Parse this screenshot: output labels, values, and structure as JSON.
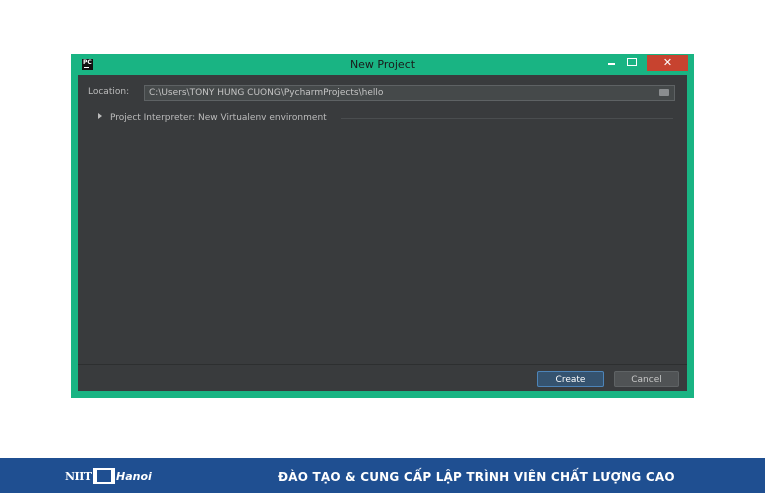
{
  "window": {
    "title": "New Project",
    "app_icon_text": "PC",
    "close_glyph": "✕",
    "icons": {
      "app": "pycharm-icon",
      "minimize": "minimize-icon",
      "maximize": "maximize-icon",
      "close": "close-icon"
    },
    "colors": {
      "frame": "#19b483",
      "client_bg": "#393b3d",
      "close_button": "#c7432f",
      "primary_button": "#35536f"
    }
  },
  "form": {
    "location_label": "Location:",
    "location_value": "C:\\Users\\TONY HUNG CUONG\\PycharmProjects\\hello",
    "folder_icon": "folder-icon",
    "interpreter_label": "Project Interpreter: New Virtualenv environment"
  },
  "buttons": {
    "create": "Create",
    "cancel": "Cancel"
  },
  "banner": {
    "logo_left": "NIIT",
    "logo_right": "Hanoi",
    "slogan": "ĐÀO TẠO & CUNG CẤP LẬP TRÌNH VIÊN CHẤT LƯỢNG CAO",
    "colors": {
      "background": "#1f4f91"
    }
  }
}
